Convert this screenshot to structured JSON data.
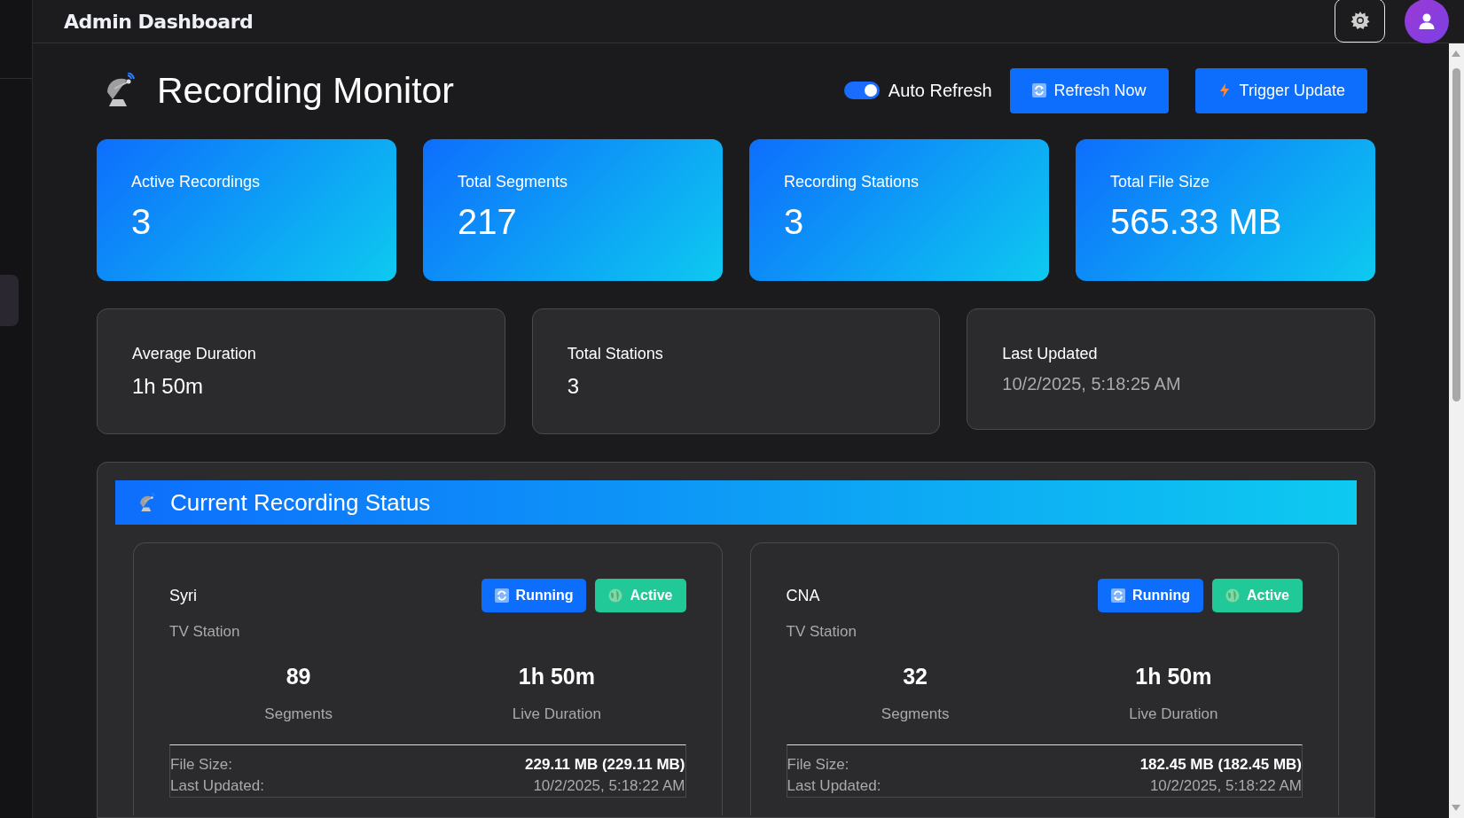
{
  "header": {
    "title": "Admin Dashboard"
  },
  "page": {
    "title": "Recording Monitor"
  },
  "toolbar": {
    "auto_refresh": {
      "label": "Auto Refresh",
      "on": true
    },
    "buttons": [
      {
        "kind": "refresh",
        "label": "Refresh Now"
      },
      {
        "kind": "trigger",
        "label": "Trigger Update"
      }
    ]
  },
  "stat_cards": [
    {
      "label": "Active Recordings",
      "value": "3"
    },
    {
      "label": "Total Segments",
      "value": "217"
    },
    {
      "label": "Recording Stations",
      "value": "3"
    },
    {
      "label": "Total File Size",
      "value": "565.33 MB"
    }
  ],
  "info_cards": [
    {
      "kind": "metric",
      "label": "Average Duration",
      "value": "1h 50m"
    },
    {
      "kind": "metric",
      "label": "Total Stations",
      "value": "3"
    },
    {
      "kind": "timestamp",
      "label": "Last Updated",
      "value": "10/2/2025, 5:18:25 AM"
    }
  ],
  "status_section": {
    "title": "Current Recording Status",
    "stations": [
      {
        "name": "Syri",
        "type": "TV Station",
        "badges": [
          {
            "kind": "running",
            "label": "Running"
          },
          {
            "kind": "active",
            "label": "Active"
          }
        ],
        "segments": "89",
        "segments_label": "Segments",
        "duration": "1h 50m",
        "duration_label": "Live Duration",
        "file_size_label": "File Size:",
        "file_size": "229.11 MB (229.11 MB)",
        "updated_label": "Last Updated:",
        "updated": "10/2/2025, 5:18:22 AM"
      },
      {
        "name": "CNA",
        "type": "TV Station",
        "badges": [
          {
            "kind": "running",
            "label": "Running"
          },
          {
            "kind": "active",
            "label": "Active"
          }
        ],
        "segments": "32",
        "segments_label": "Segments",
        "duration": "1h 50m",
        "duration_label": "Live Duration",
        "file_size_label": "File Size:",
        "file_size": "182.45 MB (182.45 MB)",
        "updated_label": "Last Updated:",
        "updated": "10/2/2025, 5:18:22 AM"
      }
    ]
  }
}
